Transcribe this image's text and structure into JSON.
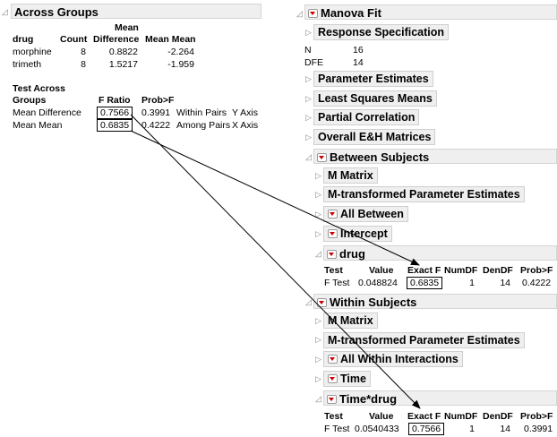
{
  "across_groups": {
    "title": "Across Groups",
    "col_mean_top": "Mean",
    "headers": [
      "drug",
      "Count",
      "Difference",
      "Mean Mean"
    ],
    "rows": [
      [
        "morphine",
        "8",
        "0.8822",
        "-2.264"
      ],
      [
        "trimeth",
        "8",
        "1.5217",
        "-1.959"
      ]
    ],
    "test_title_1": "Test Across",
    "test_headers": [
      "Groups",
      "F Ratio",
      "Prob>F"
    ],
    "test_rows": [
      [
        "Mean Difference",
        "0.7566",
        "0.3991",
        "Within Pairs",
        "Y Axis"
      ],
      [
        "Mean Mean",
        "0.6835",
        "0.4222",
        "Among Pairs",
        "X Axis"
      ]
    ]
  },
  "manova": {
    "title": "Manova Fit",
    "response_spec": "Response Specification",
    "n_label": "N",
    "n_value": "16",
    "dfe_label": "DFE",
    "dfe_value": "14",
    "parameter_estimates": "Parameter Estimates",
    "least_squares_means": "Least Squares Means",
    "partial_correlation": "Partial Correlation",
    "overall_eh": "Overall E&H Matrices",
    "between": {
      "title": "Between Subjects",
      "m_matrix": "M Matrix",
      "m_transformed": "M-transformed Parameter Estimates",
      "all_between": "All Between",
      "intercept": "Intercept",
      "drug": {
        "title": "drug",
        "headers": [
          "Test",
          "Value",
          "Exact F",
          "NumDF",
          "DenDF",
          "Prob>F"
        ],
        "row": [
          "F Test",
          "0.048824",
          "0.6835",
          "1",
          "14",
          "0.4222"
        ]
      }
    },
    "within": {
      "title": "Within Subjects",
      "m_matrix": "M Matrix",
      "m_transformed": "M-transformed Parameter Estimates",
      "all_within": "All Within Interactions",
      "time": "Time",
      "time_drug": {
        "title": "Time*drug",
        "headers": [
          "Test",
          "Value",
          "Exact F",
          "NumDF",
          "DenDF",
          "Prob>F"
        ],
        "row": [
          "F Test",
          "0.0540433",
          "0.7566",
          "1",
          "14",
          "0.3991"
        ]
      }
    }
  }
}
